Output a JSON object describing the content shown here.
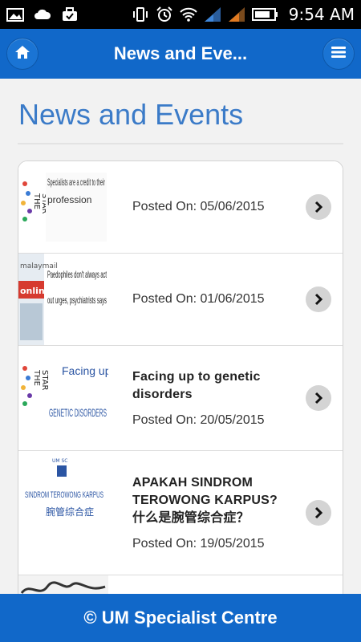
{
  "status_bar": {
    "time": "9:54 AM",
    "icons": [
      "gallery-icon",
      "cloud-icon",
      "briefcase-icon",
      "vibrate-icon",
      "alarm-icon",
      "wifi-icon",
      "signal-icon",
      "signal-icon",
      "battery-icon"
    ]
  },
  "app_bar": {
    "title": "News and Eve...",
    "home_icon": "home-icon",
    "menu_icon": "hamburger-menu-icon",
    "color": "#1168c9"
  },
  "page": {
    "heading": "News and Events",
    "heading_color": "#3b7bc8"
  },
  "news": [
    {
      "thumb_text": "Specialists are a credit to their profession",
      "title": "",
      "date": "Posted On: 05/06/2015"
    },
    {
      "thumb_text": "Paedophiles don't always act out urges, psychiatrists says",
      "thumb_brand": "online",
      "title": "",
      "date": "Posted On: 01/06/2015"
    },
    {
      "thumb_text": "Facing up to GENETIC DISORDERS",
      "title": "Facing up to genetic disorders",
      "date": "Posted On: 20/05/2015"
    },
    {
      "thumb_text": "SINDROM TEROWONG KARPUS 腕管综合症",
      "title": "APAKAH SINDROM TEROWONG KARPUS?\n什么是腕管综合症？",
      "date": "Posted On: 19/05/2015"
    }
  ],
  "footer": {
    "text": "© UM Specialist Centre"
  }
}
